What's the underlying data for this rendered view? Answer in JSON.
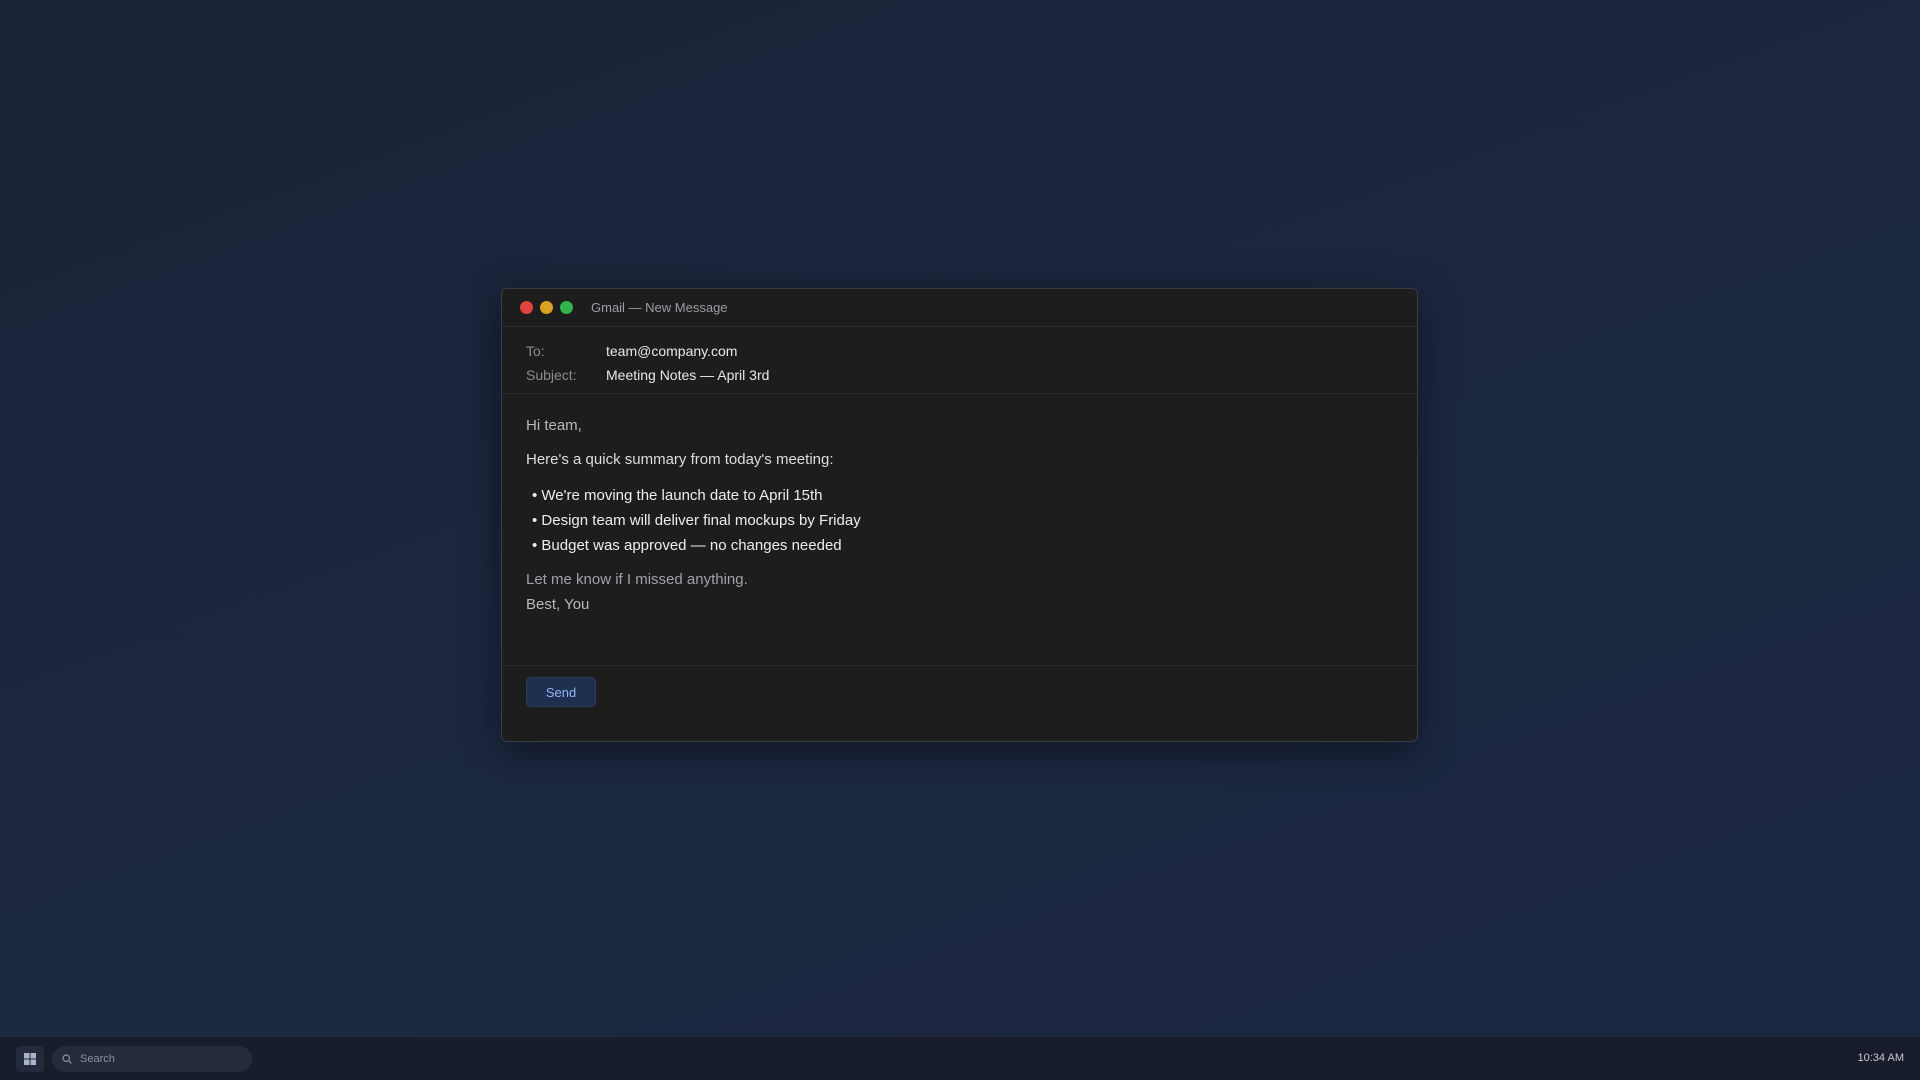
{
  "window": {
    "title": "Gmail — New Message",
    "traffic_lights": {
      "close_color": "#e0443e",
      "minimize_color": "#d9a223",
      "maximize_color": "#2fb54a"
    }
  },
  "compose": {
    "to_label": "To:",
    "to_value": "team@company.com",
    "subject_label": "Subject:",
    "subject_value": "Meeting Notes — April 3rd",
    "greeting": "Hi team,",
    "intro": "Here's a quick summary from today's meeting:",
    "bullets": [
      "• We're moving the launch date to April 15th",
      "• Design team will deliver final mockups by Friday",
      "• Budget was approved — no changes needed"
    ],
    "outro": "Let me know if I missed anything.",
    "signoff": "Best, You",
    "send_label": "Send"
  },
  "taskbar": {
    "start_icon": "windows-grid-icon",
    "search_icon": "search-icon",
    "search_placeholder": "Search",
    "clock": "10:34 AM"
  },
  "colors": {
    "desktop_bg": "#1c2538",
    "window_bg": "#1d1d1e",
    "send_button_bg": "#1f2f4f",
    "send_button_text": "#8fb6f3"
  }
}
